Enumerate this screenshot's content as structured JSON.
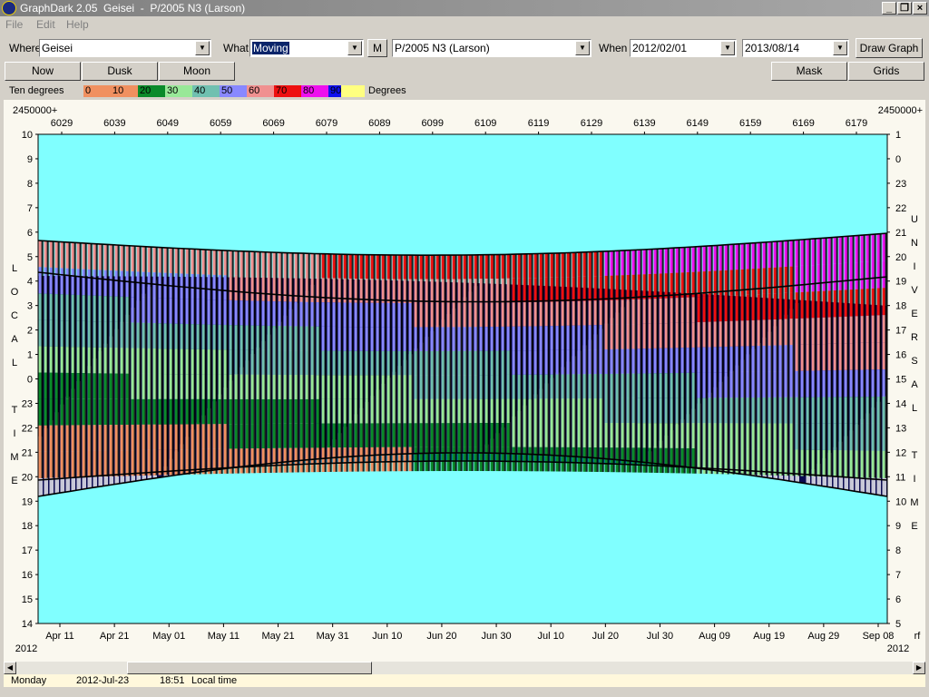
{
  "window": {
    "title": "GraphDark 2.05  Geisei  -  P/2005 N3 (Larson)"
  },
  "menu": [
    "File",
    "Edit",
    "Help"
  ],
  "toolbar": {
    "where_label": "Where",
    "where_value": "Geisei",
    "what_label": "What",
    "what_value": "Moving",
    "m_button": "M",
    "object_value": "P/2005 N3 (Larson)",
    "when_label": "When",
    "start_date": "2012/02/01",
    "end_date": "2013/08/14",
    "draw_button": "Draw Graph"
  },
  "buttons": {
    "now": "Now",
    "dusk": "Dusk",
    "moon": "Moon",
    "mask": "Mask",
    "grids": "Grids"
  },
  "legend": {
    "label": "Ten degrees",
    "unit": "Degrees",
    "items": [
      {
        "text": "0",
        "color": "#f09060"
      },
      {
        "text": "10",
        "color": "#f09060"
      },
      {
        "text": "20",
        "color": "#0a8a2a"
      },
      {
        "text": "30",
        "color": "#98e898"
      },
      {
        "text": "40",
        "color": "#70c0b0"
      },
      {
        "text": "50",
        "color": "#8888ff"
      },
      {
        "text": "60",
        "color": "#f09090"
      },
      {
        "text": "70",
        "color": "#ee1010"
      },
      {
        "text": "80",
        "color": "#ee10ee"
      },
      {
        "text": "90",
        "color": "#1010ee"
      },
      {
        "text": "",
        "color": "#ffff80"
      }
    ]
  },
  "chart_data": {
    "type": "heatmap",
    "top_axis_prefix": "2450000+",
    "top_axis_prefix_right": "2450000+",
    "top_axis_ticks": [
      "6029",
      "6039",
      "6049",
      "6059",
      "6069",
      "6079",
      "6089",
      "6099",
      "6109",
      "6119",
      "6129",
      "6139",
      "6149",
      "6159",
      "6169",
      "6179"
    ],
    "left_axis_ticks": [
      "10",
      "9",
      "8",
      "7",
      "6",
      "5",
      "4",
      "3",
      "2",
      "1",
      "0",
      "23",
      "22",
      "21",
      "20",
      "19",
      "18",
      "17",
      "16",
      "15",
      "14"
    ],
    "right_axis_ticks": [
      "1",
      "0",
      "23",
      "22",
      "21",
      "20",
      "19",
      "18",
      "17",
      "16",
      "15",
      "14",
      "13",
      "12",
      "11",
      "10",
      "9",
      "8",
      "7",
      "6",
      "5"
    ],
    "left_axis_label": [
      "L",
      "O",
      "C",
      "A",
      "L",
      "",
      "T",
      "I",
      "M",
      "E"
    ],
    "right_axis_label": [
      "U",
      "N",
      "I",
      "V",
      "E",
      "R",
      "S",
      "A",
      "L",
      "",
      "T",
      "I",
      "M",
      "E"
    ],
    "bottom_axis_ticks": [
      "Apr 11",
      "Apr 21",
      "May 01",
      "May 11",
      "May 21",
      "May 31",
      "Jun 10",
      "Jun 20",
      "Jun 30",
      "Jul 10",
      "Jul 20",
      "Jul 30",
      "Aug 09",
      "Aug 19",
      "Aug 29",
      "Sep 08"
    ],
    "year_left": "2012",
    "year_right": "2012",
    "corner_label": "rf",
    "colors": {
      "background": "#80ffff",
      "night": "#0a0a50",
      "twilight": "#0080c0",
      "moonlight": "#c8c8d8",
      "bars": "#000000"
    }
  },
  "status": {
    "day": "Monday",
    "date": "2012-Jul-23",
    "time": "18:51",
    "label": "Local time"
  }
}
